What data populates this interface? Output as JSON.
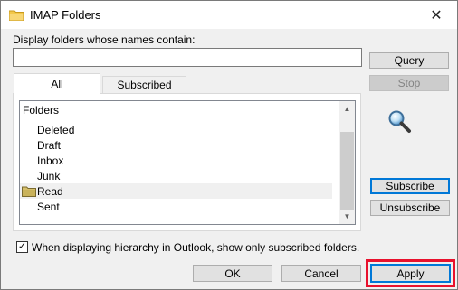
{
  "window": {
    "title": "IMAP Folders",
    "close_glyph": "✕"
  },
  "filter": {
    "label": "Display folders whose names contain:",
    "value": "",
    "placeholder": ""
  },
  "tabs": [
    {
      "label": "All",
      "active": true
    },
    {
      "label": "Subscribed",
      "active": false
    }
  ],
  "tree": {
    "header": "Folders",
    "items": [
      {
        "label": "Deleted",
        "selected": false,
        "icon": ""
      },
      {
        "label": "Draft",
        "selected": false,
        "icon": ""
      },
      {
        "label": "Inbox",
        "selected": false,
        "icon": ""
      },
      {
        "label": "Junk",
        "selected": false,
        "icon": ""
      },
      {
        "label": "Read",
        "selected": true,
        "icon": "folder-icon"
      },
      {
        "label": "Sent",
        "selected": false,
        "icon": ""
      }
    ]
  },
  "buttons": {
    "query": "Query",
    "stop": "Stop",
    "subscribe": "Subscribe",
    "unsubscribe": "Unsubscribe",
    "ok": "OK",
    "cancel": "Cancel",
    "apply": "Apply"
  },
  "option": {
    "checked": true,
    "label": "When displaying hierarchy in Outlook, show only subscribed folders."
  },
  "colors": {
    "highlight": "#e8112d",
    "default_button_border": "#0078d7",
    "folder": "#d6bf6b"
  }
}
